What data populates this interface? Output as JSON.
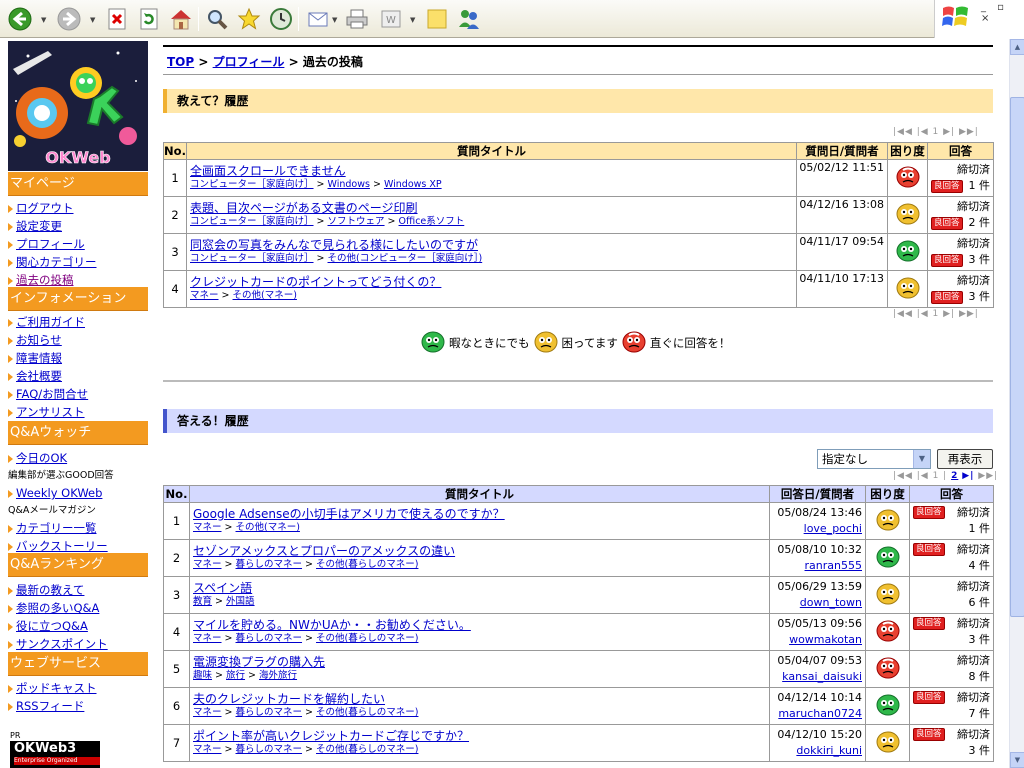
{
  "toolbar": {
    "buttons": [
      "back-icon",
      "forward-icon",
      "stop-icon",
      "refresh-icon",
      "home-icon",
      "search-icon",
      "favorites-icon",
      "history-icon",
      "mail-icon",
      "print-icon",
      "edit-icon",
      "note-icon",
      "messenger-icon"
    ]
  },
  "sidebar": {
    "sections": [
      {
        "title": "マイページ",
        "items": [
          "ログアウト",
          "設定変更",
          "プロフィール",
          "関心カテゴリー",
          "過去の投稿"
        ]
      },
      {
        "title": "インフォメーション",
        "items": [
          "ご利用ガイド",
          "お知らせ",
          "障害情報",
          "会社概要",
          "FAQ/お問合せ",
          "アンサリスト"
        ]
      },
      {
        "title": "Q&Aウォッチ",
        "items": [
          "今日のOK",
          "Weekly OKWeb",
          "カテゴリー一覧",
          "バックストーリー"
        ],
        "notes": [
          "編集部が選ぶGOOD回答",
          "Q&Aメールマガジン"
        ]
      },
      {
        "title": "Q&Aランキング",
        "items": [
          "最新の教えて",
          "参照の多いQ&A",
          "役に立つQ&A",
          "サンクスポイント"
        ]
      },
      {
        "title": "ウェブサービス",
        "items": [
          "ポッドキャスト",
          "RSSフィード"
        ]
      }
    ],
    "logo_text": "OKWeb",
    "pr": "PR",
    "banner": "OKWeb3",
    "banner_sub": "Enterprise Organized"
  },
  "breadcrumb": {
    "top": "TOP",
    "profile": "プロフィール",
    "current": "過去の投稿",
    "sep": ">"
  },
  "questions": {
    "heading": "教えて？履歴",
    "pager": "|◀◀ |◀ 1 ▶| ▶▶|",
    "columns": [
      "No.",
      "質問タイトル",
      "質問日/質問者",
      "困り度",
      "回答"
    ],
    "rows": [
      {
        "no": "1",
        "title": "全画面スクロールできません",
        "cats": [
          "コンピューター［家庭向け］",
          "Windows",
          "Windows XP"
        ],
        "date": "05/02/12 11:51",
        "face": "urgent",
        "status": "締切済",
        "good": "良回答",
        "count": "1 件"
      },
      {
        "no": "2",
        "title": "表題、目次ページがある文書のページ印刷",
        "cats": [
          "コンピューター［家庭向け］",
          "ソフトウェア",
          "Office系ソフト"
        ],
        "date": "04/12/16 13:08",
        "face": "troubled",
        "status": "締切済",
        "good": "良回答",
        "count": "2 件"
      },
      {
        "no": "3",
        "title": "同窓会の写真をみんなで見られる様にしたいのですが",
        "cats": [
          "コンピューター［家庭向け］",
          "その他(コンピューター［家庭向け］)"
        ],
        "date": "04/11/17 09:54",
        "face": "relaxed",
        "status": "締切済",
        "good": "良回答",
        "count": "3 件"
      },
      {
        "no": "4",
        "title": "クレジットカードのポイントってどう付くの？",
        "cats": [
          "マネー",
          "その他(マネー)"
        ],
        "date": "04/11/10 17:13",
        "face": "troubled",
        "status": "締切済",
        "good": "良回答",
        "count": "3 件"
      }
    ]
  },
  "legend": {
    "relaxed": "暇なときにでも",
    "troubled": "困ってます",
    "urgent": "直ぐに回答を！"
  },
  "answers": {
    "heading": "答える！履歴",
    "select_value": "指定なし",
    "redisplay": "再表示",
    "pager_cur": "1",
    "pager_next": "2",
    "columns": [
      "No.",
      "質問タイトル",
      "回答日/質問者",
      "困り度",
      "回答"
    ],
    "rows": [
      {
        "no": "1",
        "title": "Google Adsenseの小切手はアメリカで使えるのですか？",
        "cats": [
          "マネー",
          "その他(マネー)"
        ],
        "date": "05/08/24 13:46",
        "user": "love_pochi",
        "face": "troubled",
        "good": "良回答",
        "status": "締切済",
        "count": "1 件"
      },
      {
        "no": "2",
        "title": "セゾンアメックスとプロパーのアメックスの違い",
        "cats": [
          "マネー",
          "暮らしのマネー",
          "その他(暮らしのマネー)"
        ],
        "date": "05/08/10 10:32",
        "user": "ranran555",
        "face": "relaxed",
        "good": "良回答",
        "status": "締切済",
        "count": "4 件"
      },
      {
        "no": "3",
        "title": "スペイン語",
        "cats": [
          "教育",
          "外国語"
        ],
        "date": "05/06/29 13:59",
        "user": "down_town",
        "face": "troubled",
        "good": "",
        "status": "締切済",
        "count": "6 件"
      },
      {
        "no": "4",
        "title": "マイルを貯める。NWかUAか・・お勧めください。",
        "cats": [
          "マネー",
          "暮らしのマネー",
          "その他(暮らしのマネー)"
        ],
        "date": "05/05/13 09:56",
        "user": "wowmakotan",
        "face": "urgent",
        "good": "良回答",
        "status": "締切済",
        "count": "3 件"
      },
      {
        "no": "5",
        "title": "電源変換プラグの購入先",
        "cats": [
          "趣味",
          "旅行",
          "海外旅行"
        ],
        "date": "05/04/07 09:53",
        "user": "kansai_daisuki",
        "face": "urgent",
        "good": "",
        "status": "締切済",
        "count": "8 件"
      },
      {
        "no": "6",
        "title": "夫のクレジットカードを解約したい",
        "cats": [
          "マネー",
          "暮らしのマネー",
          "その他(暮らしのマネー)"
        ],
        "date": "04/12/14 10:14",
        "user": "maruchan0724",
        "face": "relaxed",
        "good": "良回答",
        "status": "締切済",
        "count": "7 件"
      },
      {
        "no": "7",
        "title": "ポイント率が高いクレジットカードご存じですか？",
        "cats": [
          "マネー",
          "暮らしのマネー",
          "その他(暮らしのマネー)"
        ],
        "date": "04/12/10 15:20",
        "user": "dokkiri_kuni",
        "face": "troubled",
        "good": "良回答",
        "status": "締切済",
        "count": "3 件"
      }
    ]
  },
  "colors": {
    "orange": "#f39a20",
    "qhead": "#ffe7aa",
    "ahead": "#d4d9ff",
    "good": "#e02020"
  }
}
